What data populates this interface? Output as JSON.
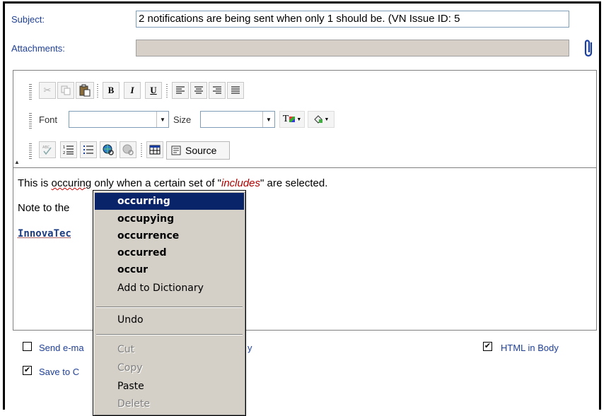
{
  "form": {
    "subject_label": "Subject:",
    "subject_value": "2 notifications are being sent when only 1 should be. (VN Issue ID: 5",
    "attachments_label": "Attachments:"
  },
  "toolbar": {
    "bold": "B",
    "italic": "I",
    "underline": "U",
    "font_label": "Font",
    "size_label": "Size",
    "font_color_glyph": "T",
    "source_label": "Source"
  },
  "editor": {
    "line1": {
      "pre": "This is ",
      "misspelled": "occuring",
      "mid": " only when a certain set of \"",
      "italic": "includes",
      "post": "\" are selected."
    },
    "line2": "Note to the",
    "line3": "InnovaTec"
  },
  "options": {
    "send_email_label": "Send e-ma",
    "send_email_tail": "y",
    "save_label": "Save to C",
    "html_body_label": "HTML in Body",
    "check_glyph": "✔"
  },
  "context_menu": {
    "suggestions": [
      "occurring",
      "occupying",
      "occurrence",
      "occurred",
      "occur"
    ],
    "add_to_dictionary": "Add to Dictionary",
    "undo": "Undo",
    "cut": "Cut",
    "copy": "Copy",
    "paste": "Paste",
    "delete": "Delete"
  }
}
